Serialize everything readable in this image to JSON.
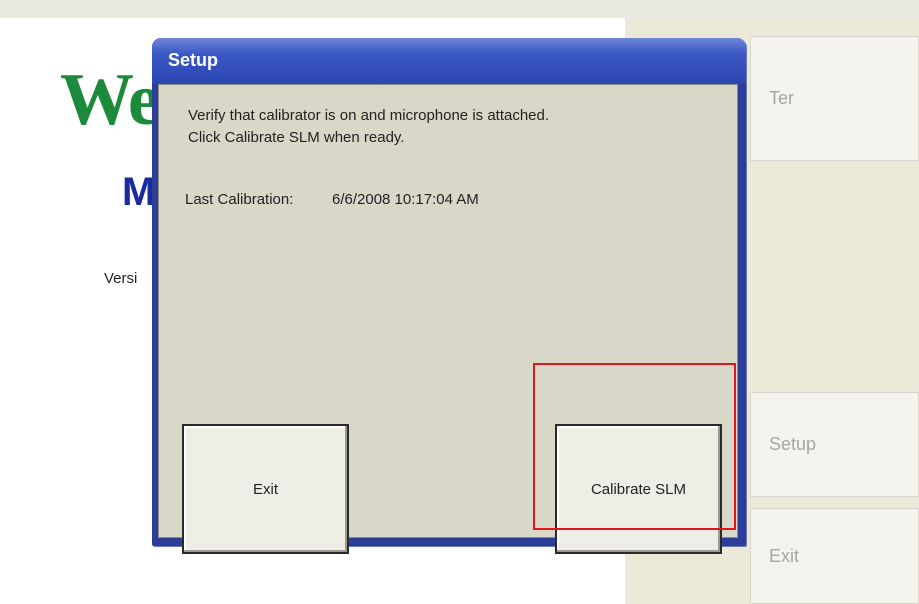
{
  "background": {
    "welcome_text": "We",
    "sub_text": "M",
    "version_text": "Versi",
    "side_buttons": {
      "top_label": "Ter",
      "setup_label": "Setup",
      "exit_label": "Exit"
    }
  },
  "dialog": {
    "title": "Setup",
    "instruction_line1": "Verify that calibrator is on and microphone is attached.",
    "instruction_line2": "Click Calibrate SLM when ready.",
    "last_calibration_label": "Last Calibration:",
    "last_calibration_value": "6/6/2008 10:17:04 AM",
    "buttons": {
      "exit": "Exit",
      "calibrate": "Calibrate SLM"
    }
  },
  "colors": {
    "title_bar": "#3a57c4",
    "dialog_bg": "#d8d7c8",
    "highlight": "#e0141c",
    "welcome_green": "#1b8a3a"
  }
}
